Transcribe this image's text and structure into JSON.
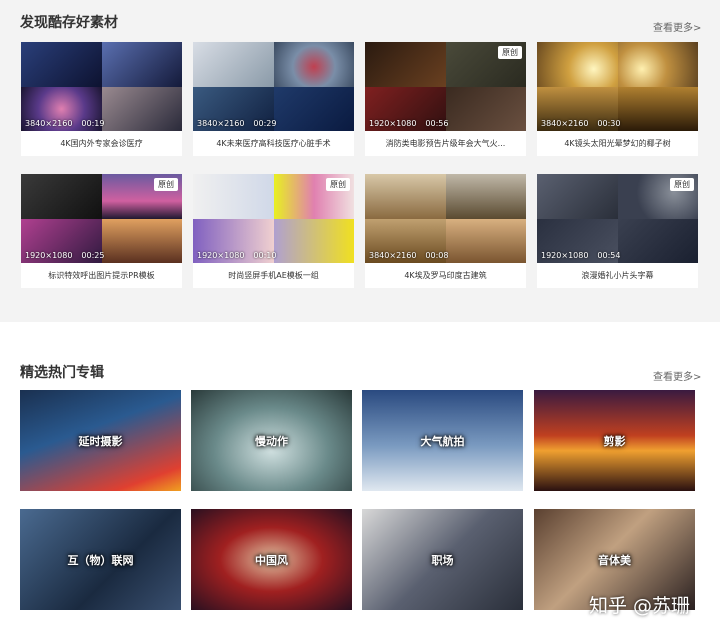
{
  "section1": {
    "title": "发现酷存好素材",
    "more": "查看更多>",
    "cards": [
      {
        "resolution": "3840×2160",
        "duration": "00:19",
        "badge": "",
        "caption": "4K国内外专家会诊医疗"
      },
      {
        "resolution": "3840×2160",
        "duration": "00:29",
        "badge": "",
        "caption": "4K未来医疗高科技医疗心脏手术"
      },
      {
        "resolution": "1920×1080",
        "duration": "00:56",
        "badge": "原创",
        "caption": "消防类电影预告片级年会大气火..."
      },
      {
        "resolution": "3840×2160",
        "duration": "00:30",
        "badge": "",
        "caption": "4K镜头太阳光晕梦幻的椰子树"
      },
      {
        "resolution": "1920×1080",
        "duration": "00:25",
        "badge": "原创",
        "caption": "标识特效呼出图片提示PR模板"
      },
      {
        "resolution": "1920×1080",
        "duration": "00:10",
        "badge": "原创",
        "caption": "时尚竖屏手机AE模板一组"
      },
      {
        "resolution": "3840×2160",
        "duration": "00:08",
        "badge": "",
        "caption": "4K埃及罗马印度古建筑"
      },
      {
        "resolution": "1920×1080",
        "duration": "00:54",
        "badge": "原创",
        "caption": "浪漫婚礼小片头字幕"
      }
    ]
  },
  "section2": {
    "title": "精选热门专辑",
    "more": "查看更多>",
    "albums": [
      {
        "label": "延时摄影"
      },
      {
        "label": "慢动作"
      },
      {
        "label": "大气航拍"
      },
      {
        "label": "剪影"
      },
      {
        "label": "互（物）联网"
      },
      {
        "label": "中国风"
      },
      {
        "label": "职场"
      },
      {
        "label": "音体美"
      }
    ]
  },
  "watermark": "知乎 @苏珊"
}
